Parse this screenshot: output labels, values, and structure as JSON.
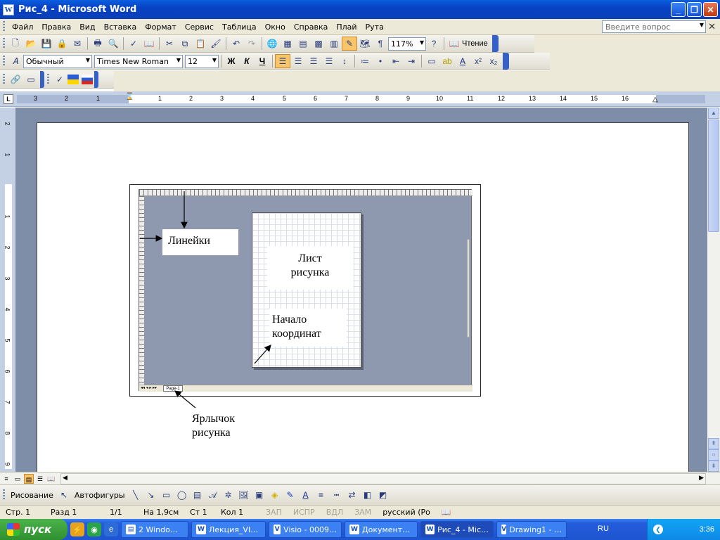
{
  "window": {
    "title": "Рис_4 - Microsoft Word",
    "app_icon": "W"
  },
  "menubar": {
    "items": [
      "Файл",
      "Правка",
      "Вид",
      "Вставка",
      "Формат",
      "Сервис",
      "Таблица",
      "Окно",
      "Справка",
      "Плай",
      "Рута"
    ],
    "ask_placeholder": "Введите вопрос"
  },
  "standard_toolbar": {
    "zoom": "117%",
    "reading_label": "Чтение"
  },
  "formatting_toolbar": {
    "style": "Обычный",
    "font": "Times New Roman",
    "size": "12",
    "bold": "Ж",
    "italic": "К",
    "underline": "Ч"
  },
  "ruler": {
    "h_numbers": [
      "3",
      "2",
      "1",
      "1",
      "2",
      "3",
      "4",
      "5",
      "6",
      "7",
      "8",
      "9",
      "10",
      "11",
      "12",
      "13",
      "14",
      "15",
      "16"
    ],
    "v_numbers": [
      "2",
      "1",
      "1",
      "2",
      "3",
      "4",
      "5",
      "6",
      "7",
      "8",
      "9"
    ]
  },
  "figure": {
    "labels": {
      "rulers": "Линейки",
      "sheet": "Лист рисунка",
      "origin": "Начало координат"
    },
    "page_tab": "Page-1",
    "caption": "Ярлычок рисунка"
  },
  "drawing_toolbar": {
    "draw_label": "Рисование",
    "autoshapes_label": "Автофигуры"
  },
  "statusbar": {
    "page": "Стр. 1",
    "section": "Разд 1",
    "pages": "1/1",
    "at": "На 1,9см",
    "line": "Ст 1",
    "col": "Кол 1",
    "rec": "ЗАП",
    "trk": "ИСПР",
    "ext": "ВДЛ",
    "ovr": "ЗАМ",
    "lang": "русский (Ро"
  },
  "taskbar": {
    "start_label": "пуск",
    "tasks": [
      {
        "label": "2 Windo…",
        "active": false
      },
      {
        "label": "Лекция_VI…",
        "active": false
      },
      {
        "label": "Visio - 0009…",
        "active": false
      },
      {
        "label": "Документ…",
        "active": false
      },
      {
        "label": "Рис_4 - Mic…",
        "active": true
      },
      {
        "label": "Drawing1 - …",
        "active": false
      }
    ],
    "lang": "RU",
    "time": "3:36"
  }
}
